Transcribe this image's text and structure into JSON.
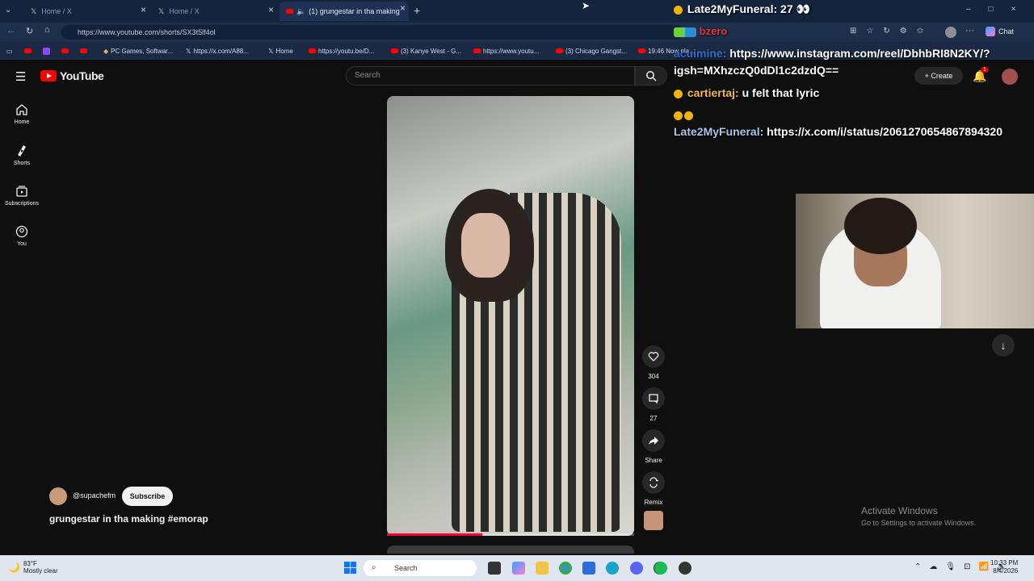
{
  "browser": {
    "tabs": [
      {
        "label": "Home / X"
      },
      {
        "label": "Home / X"
      },
      {
        "label": "(1) grungestar in tha making"
      }
    ],
    "url": "https://www.youtube.com/shorts/SX3t5lf4ol",
    "bookmarks": [
      "PC Games, Softwar...",
      "https://x.com/A88...",
      "Home",
      "https://youtu.be/D...",
      "(3) Kanye West - G...",
      "https://www.youtu...",
      "(3) Chicago Gangst...",
      "19:46 Now pla..."
    ],
    "chat_label": "Chat"
  },
  "youtube": {
    "logo": "YouTube",
    "search_placeholder": "Search",
    "create_label": "Create",
    "notification_count": "1",
    "sidebar": [
      {
        "label": "Home",
        "icon": "home-icon"
      },
      {
        "label": "Shorts",
        "icon": "shorts-icon"
      },
      {
        "label": "Subscriptions",
        "icon": "subscriptions-icon"
      },
      {
        "label": "You",
        "icon": "you-icon"
      }
    ],
    "actions": {
      "likes": "304",
      "comments": "27",
      "share": "Share",
      "remix": "Remix"
    },
    "channel": "@supachefm",
    "subscribe": "Subscribe",
    "title": "grungestar in tha making #emorap"
  },
  "chat": {
    "line1_user": "Late2MyFuneral: 27",
    "line2_user": "bzero",
    "line3_user": "acuimine:",
    "line3_msg": "https://www.instagram.com/reel/DbhbRI8N2KY/?",
    "line4_msg": "igsh=MXhzczQ0dDl1c2dzdQ==",
    "line5_user": "cartiertaj:",
    "line5_msg": "u felt that lyric",
    "line6_user": "Late2MyFuneral:",
    "line6_msg": "https://x.com/i/status/2061270654867894320"
  },
  "watermark": {
    "line1": "Activate Windows",
    "line2": "Go to Settings to activate Windows."
  },
  "taskbar": {
    "temp": "83°F",
    "weather": "Mostly clear",
    "search": "Search",
    "time": "10:33 PM",
    "date": "8/4/2026"
  }
}
